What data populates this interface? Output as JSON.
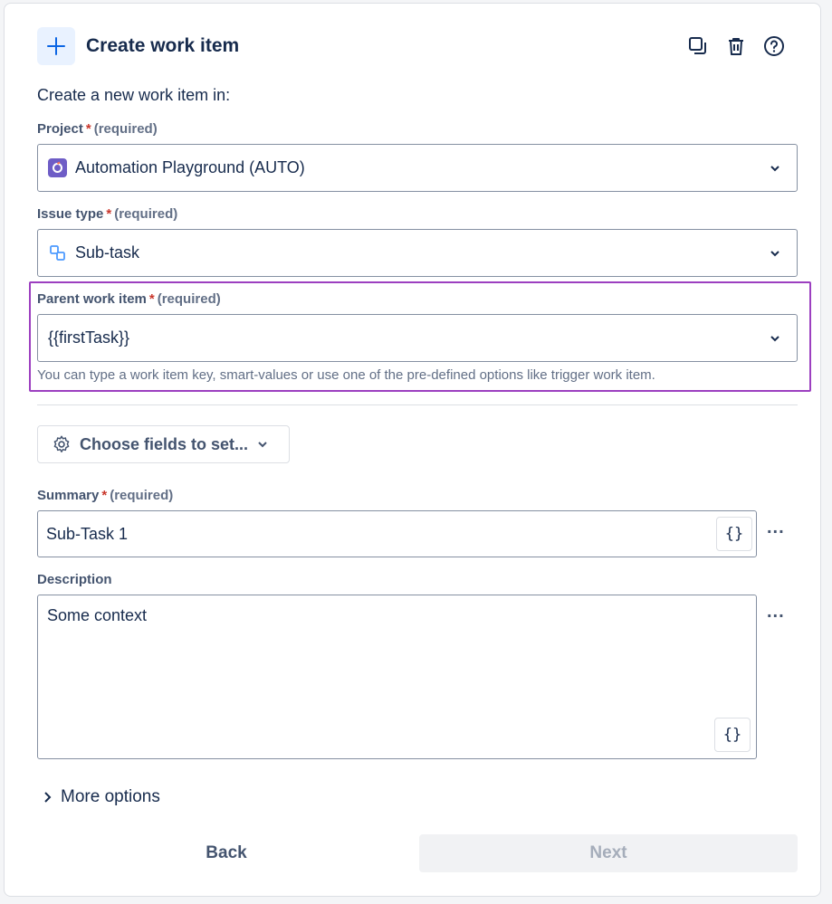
{
  "header": {
    "title": "Create work item"
  },
  "intro": "Create a new work item in:",
  "project": {
    "label": "Project",
    "required": "(required)",
    "value": "Automation Playground (AUTO)"
  },
  "issue_type": {
    "label": "Issue type",
    "required": "(required)",
    "value": "Sub-task"
  },
  "parent": {
    "label": "Parent work item",
    "required": "(required)",
    "value": "{{firstTask}}",
    "helper": "You can type a work item key, smart-values or use one of the pre-defined options like trigger work item."
  },
  "choose_fields": {
    "label": "Choose fields to set..."
  },
  "summary": {
    "label": "Summary",
    "required": "(required)",
    "value": "Sub-Task 1",
    "smart_value_label": "{}",
    "more_label": "..."
  },
  "description": {
    "label": "Description",
    "value": "Some context",
    "smart_value_label": "{}",
    "more_label": "..."
  },
  "more_options": {
    "label": "More options"
  },
  "footer": {
    "back_label": "Back",
    "next_label": "Next"
  },
  "colors": {
    "accent": "#0c66e4",
    "highlight": "#9c3fc0",
    "required_star": "#c9372c"
  }
}
